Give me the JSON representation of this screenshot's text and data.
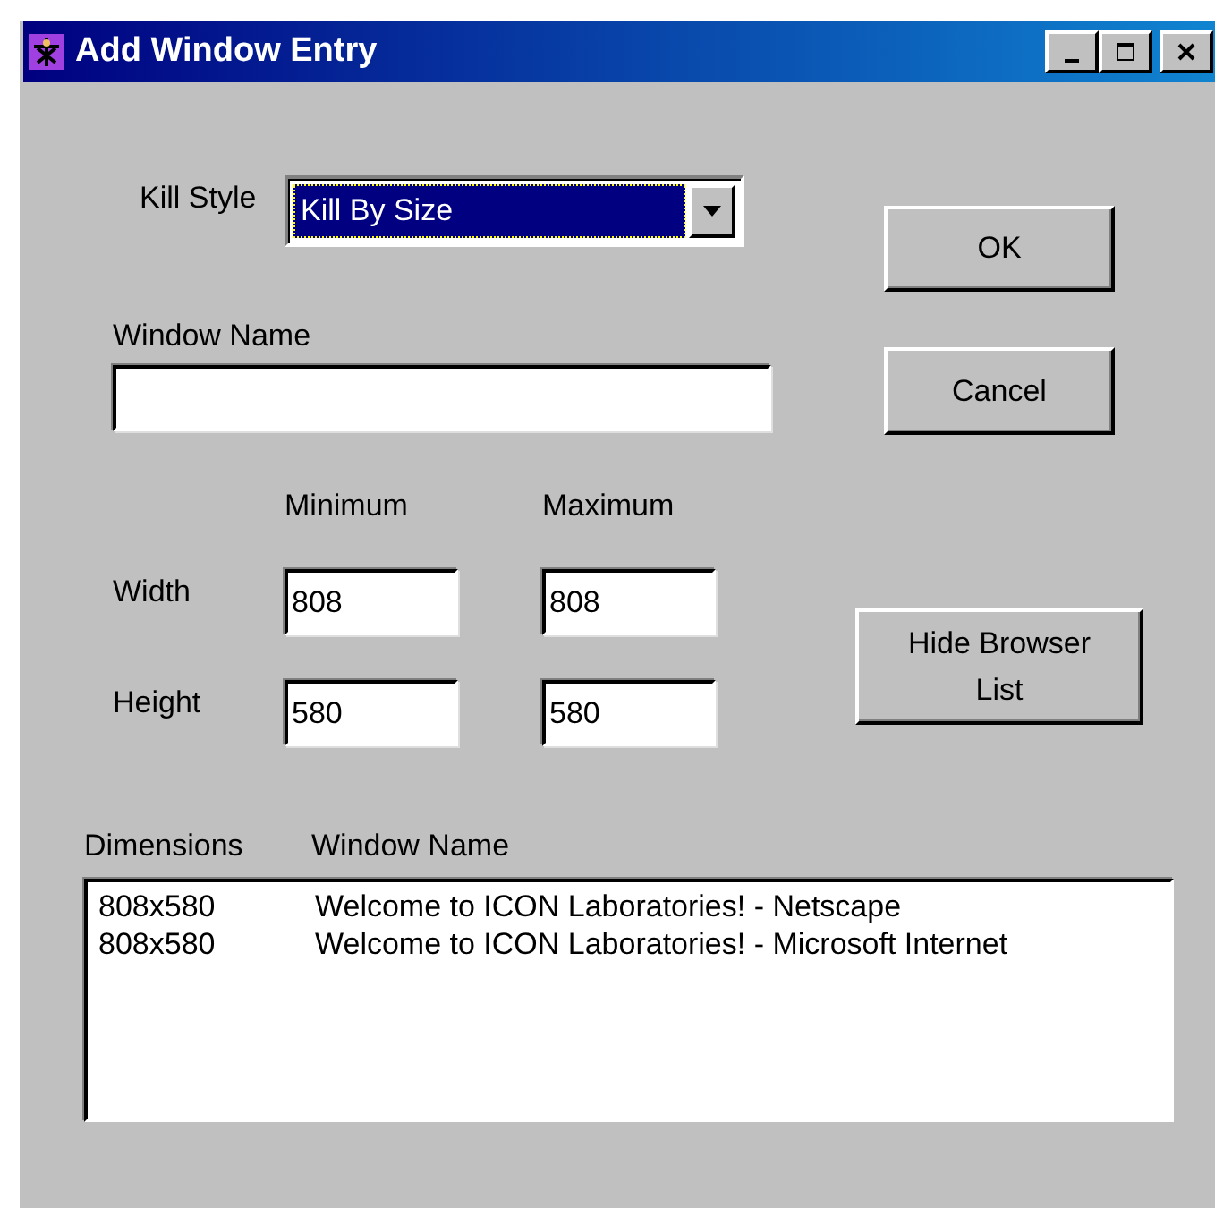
{
  "window": {
    "title": "Add Window Entry"
  },
  "kill_style": {
    "label": "Kill Style",
    "value": "Kill By Size"
  },
  "window_name": {
    "label": "Window Name"
  },
  "size": {
    "columns": [
      "Minimum",
      "Maximum"
    ],
    "rows": [
      {
        "label": "Width",
        "minimum": "808",
        "maximum": "808"
      },
      {
        "label": "Height",
        "minimum": "580",
        "maximum": "580"
      }
    ]
  },
  "buttons": [
    "OK",
    "Cancel",
    "Hide Browser List"
  ],
  "browser_list": {
    "columns": [
      "Dimensions",
      "Window Name"
    ],
    "rows": [
      {
        "dimensions": "808x580",
        "window_name": "Welcome to ICON Laboratories! - Netscape"
      },
      {
        "dimensions": "808x580",
        "window_name": "Welcome to ICON Laboratories! - Microsoft Internet"
      }
    ]
  }
}
